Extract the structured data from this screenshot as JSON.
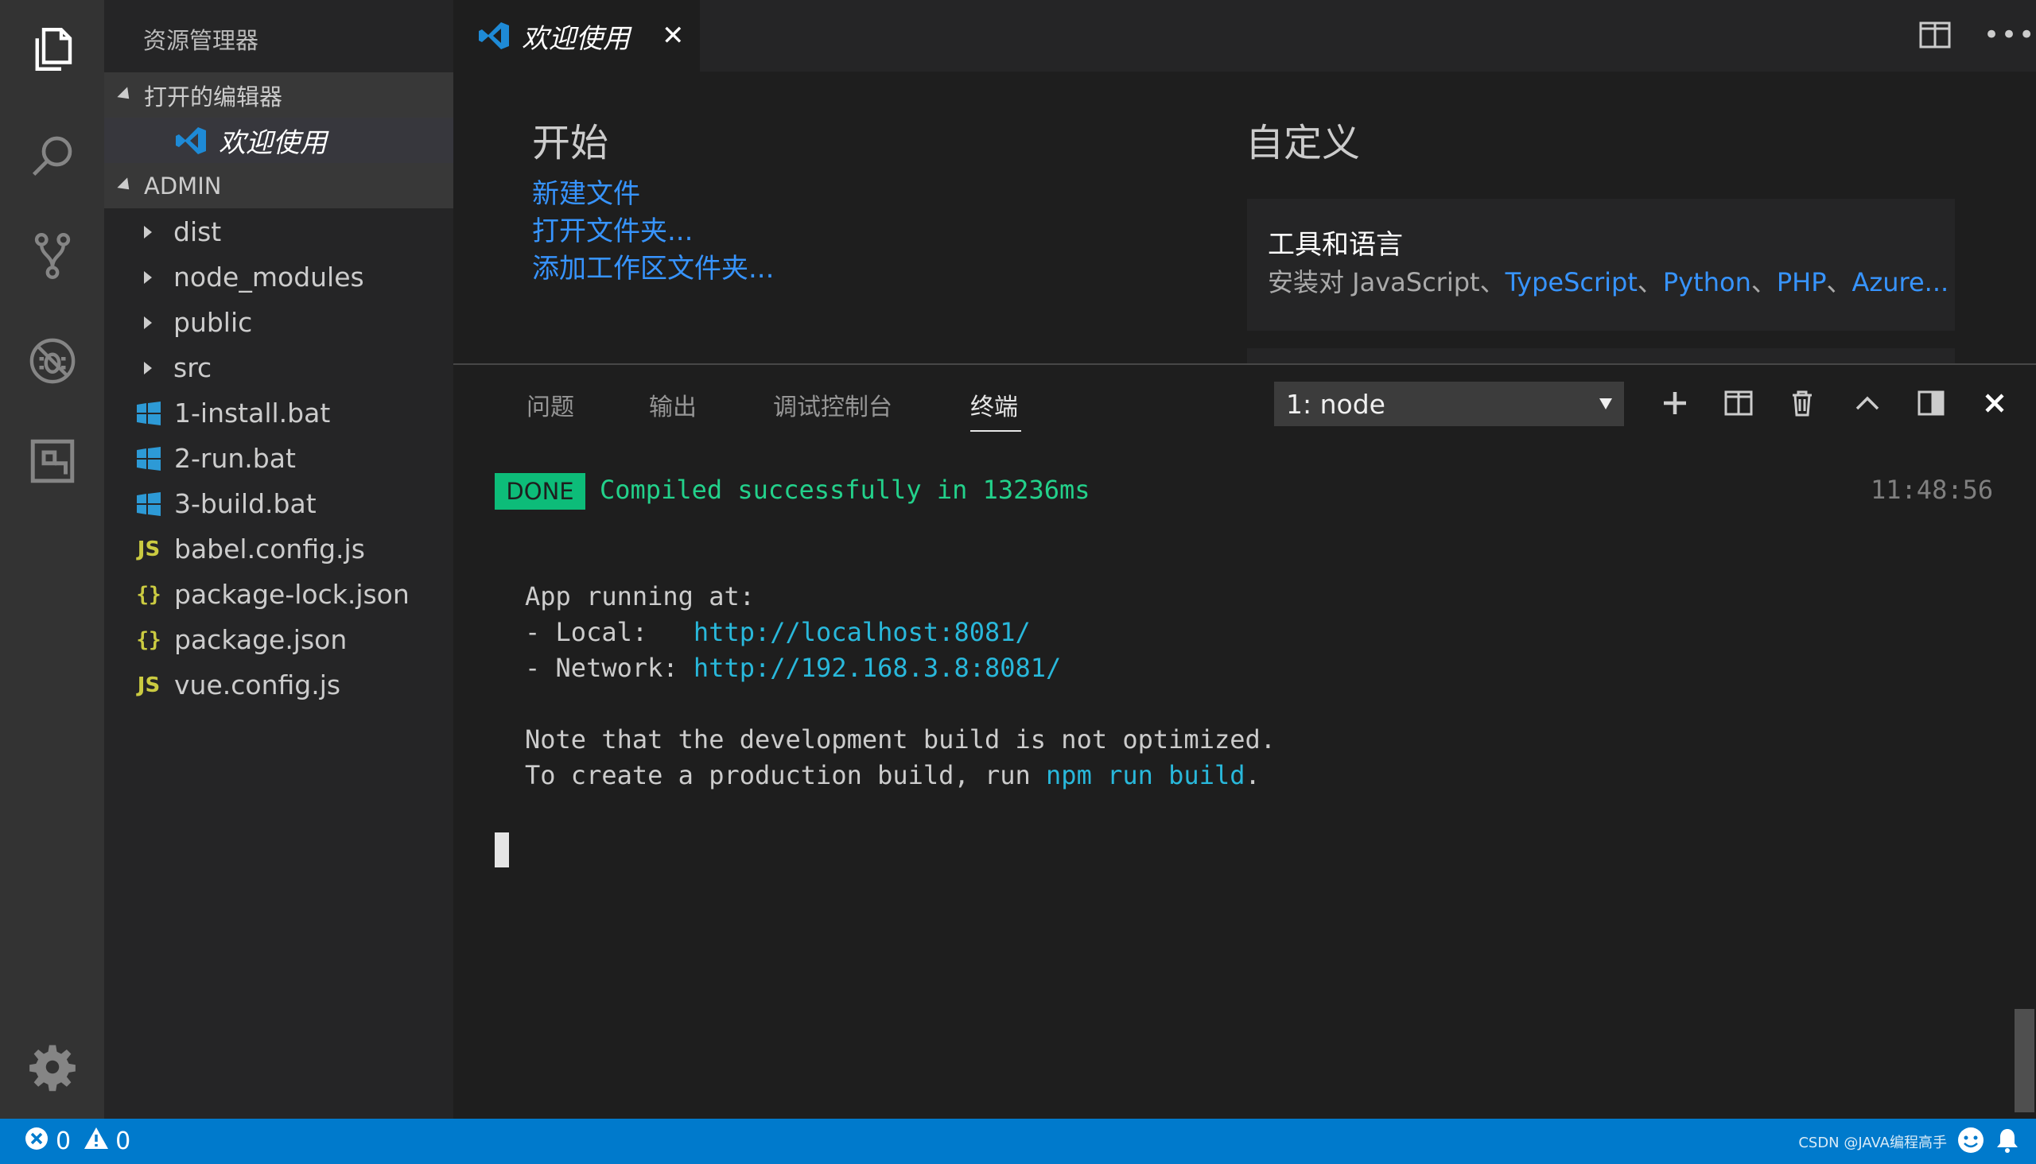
{
  "activity_bar": {
    "items": [
      "explorer-icon",
      "search-icon",
      "source-control-icon",
      "debug-icon",
      "extensions-icon"
    ],
    "bottom": "gear-icon"
  },
  "sidebar": {
    "title": "资源管理器",
    "open_editors": {
      "label": "打开的编辑器",
      "items": [
        {
          "label": "欢迎使用",
          "icon": "vscode-icon"
        }
      ]
    },
    "workspace": {
      "label": "ADMIN",
      "folders": [
        "dist",
        "node_modules",
        "public",
        "src"
      ],
      "files": [
        {
          "name": "1-install.bat",
          "icon": "windows-icon"
        },
        {
          "name": "2-run.bat",
          "icon": "windows-icon"
        },
        {
          "name": "3-build.bat",
          "icon": "windows-icon"
        },
        {
          "name": "babel.config.js",
          "icon": "js-icon",
          "glyph": "JS"
        },
        {
          "name": "package-lock.json",
          "icon": "json-icon",
          "glyph": "{}"
        },
        {
          "name": "package.json",
          "icon": "json-icon",
          "glyph": "{}"
        },
        {
          "name": "vue.config.js",
          "icon": "js-icon",
          "glyph": "JS"
        }
      ]
    }
  },
  "tabs": [
    {
      "label": "欢迎使用",
      "close": "✕"
    }
  ],
  "welcome": {
    "start": {
      "heading": "开始",
      "links": [
        "新建文件",
        "打开文件夹...",
        "添加工作区文件夹..."
      ]
    },
    "customize": {
      "heading": "自定义",
      "card_title": "工具和语言",
      "card_prefix": "安装对 JavaScript、",
      "card_links": [
        "TypeScript",
        "Python",
        "PHP",
        "Azure..."
      ],
      "card_sep": "、"
    }
  },
  "panel": {
    "tabs": [
      "问题",
      "输出",
      "调试控制台",
      "终端"
    ],
    "active_tab": "终端",
    "terminal_select": "1: node",
    "terminal": {
      "done_badge": "DONE",
      "compiled": "Compiled successfully in 13236ms",
      "time": "11:48:56",
      "app_running": "App running at:",
      "local_label": "- Local:   ",
      "local_url": "http://localhost:8081/",
      "network_label": "- Network: ",
      "network_url": "http://192.168.3.8:8081/",
      "note1": "Note that the development build is not optimized.",
      "note2_prefix": "To create a production build, run ",
      "note2_cmd": "npm run build",
      "note2_suffix": "."
    }
  },
  "status_bar": {
    "errors": "0",
    "warnings": "0",
    "watermark": "CSDN @JAVA编程高手"
  },
  "colors": {
    "accent": "#007acc",
    "link": "#3794ff",
    "terminal_link": "#29b8db",
    "success": "#23d18b",
    "done_bg": "#0dbc79"
  }
}
